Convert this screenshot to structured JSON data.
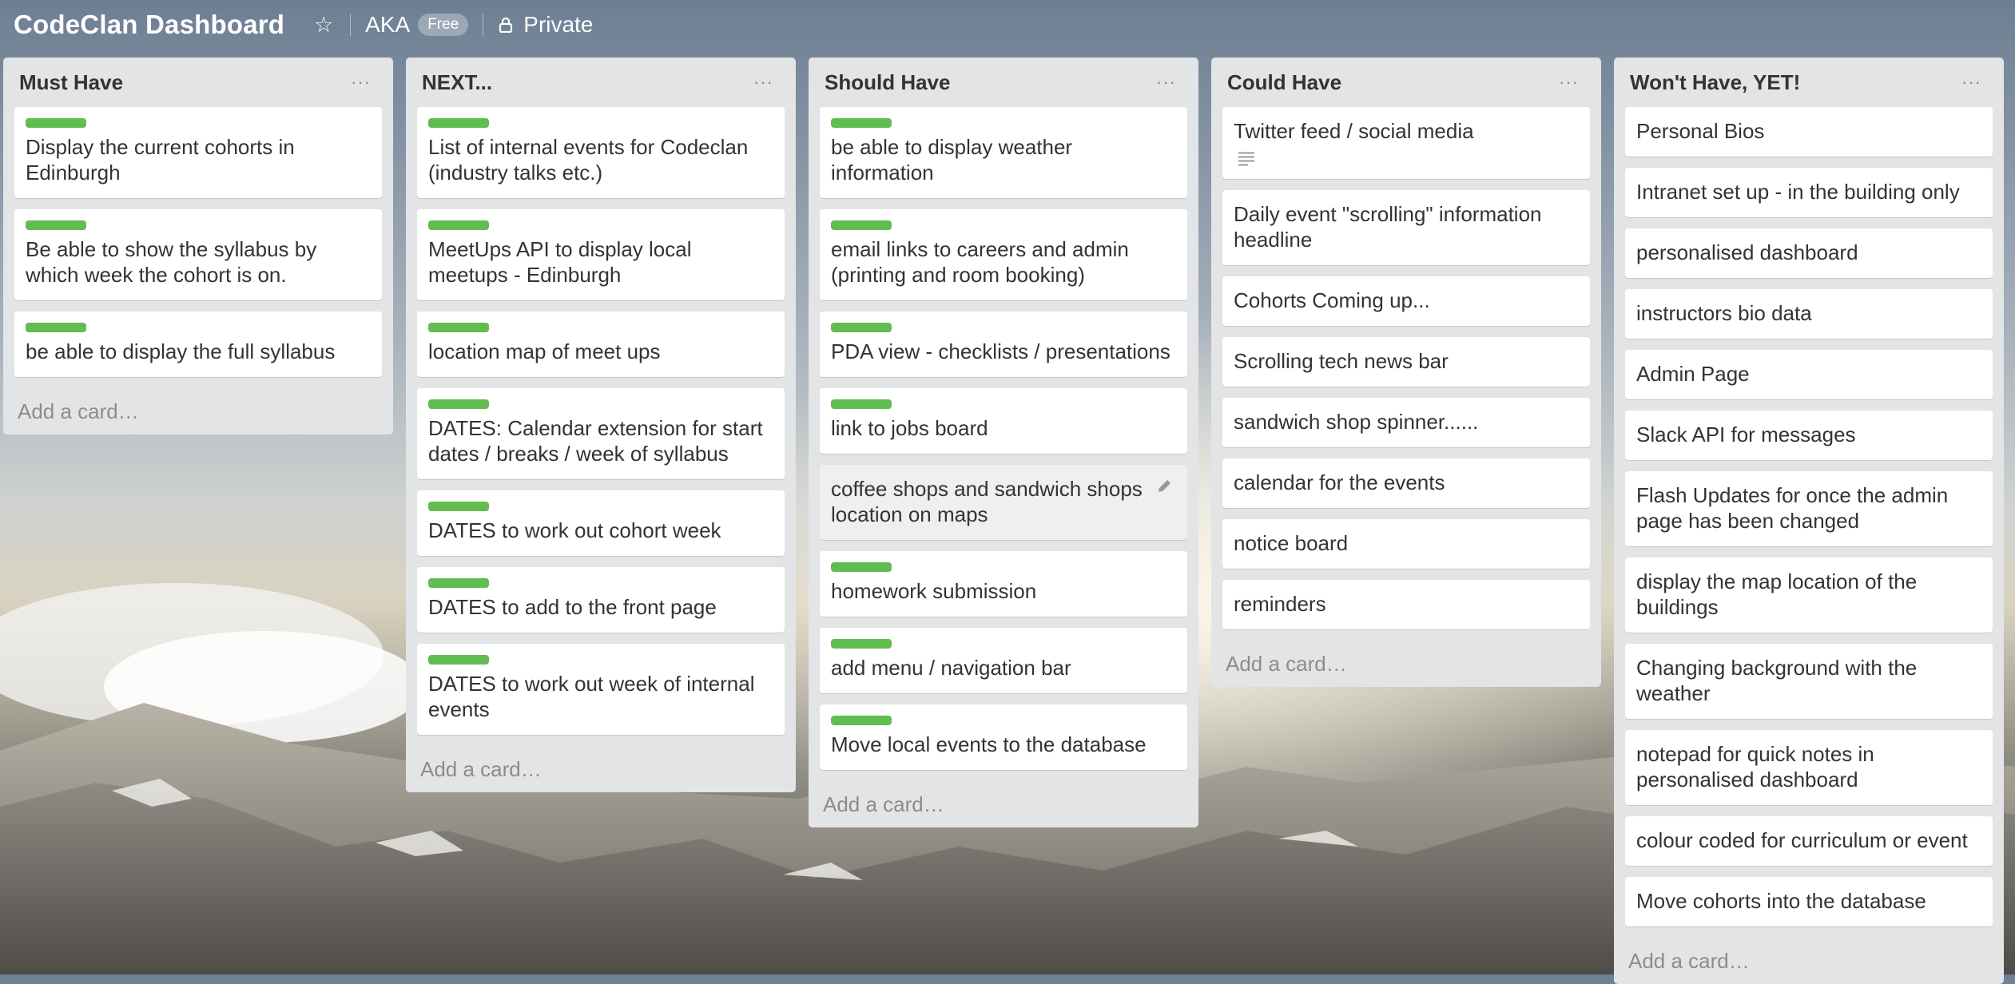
{
  "header": {
    "board_title": "CodeClan Dashboard",
    "team_name": "AKA",
    "team_badge": "Free",
    "privacy": "Private"
  },
  "add_card_label": "Add a card…",
  "lists": [
    {
      "title": "Must Have",
      "cards": [
        {
          "text": "Display the current cohorts in Edinburgh",
          "label": "green"
        },
        {
          "text": "Be able to show the syllabus by which week the cohort is on.",
          "label": "green"
        },
        {
          "text": "be able to display the full syllabus",
          "label": "green"
        }
      ]
    },
    {
      "title": "NEXT...",
      "cards": [
        {
          "text": "List of internal events for Codeclan (industry talks etc.)",
          "label": "green"
        },
        {
          "text": "MeetUps API to display local meetups - Edinburgh",
          "label": "green"
        },
        {
          "text": "location map of meet ups",
          "label": "green"
        },
        {
          "text": "DATES: Calendar extension for start dates / breaks / week of syllabus",
          "label": "green"
        },
        {
          "text": "DATES to work out cohort week",
          "label": "green"
        },
        {
          "text": "DATES to add to the front page",
          "label": "green"
        },
        {
          "text": "DATES to work out week of internal events",
          "label": "green"
        }
      ]
    },
    {
      "title": "Should Have",
      "cards": [
        {
          "text": "be able to display weather information",
          "label": "green"
        },
        {
          "text": "email links to careers and admin (printing and room booking)",
          "label": "green"
        },
        {
          "text": "PDA view - checklists / presentations",
          "label": "green"
        },
        {
          "text": "link to jobs board",
          "label": "green"
        },
        {
          "text": "coffee shops and sandwich shops location on maps",
          "label": "",
          "hover": true
        },
        {
          "text": "homework submission",
          "label": "green"
        },
        {
          "text": "add menu / navigation bar",
          "label": "green"
        },
        {
          "text": "Move local events to the database",
          "label": "green"
        }
      ]
    },
    {
      "title": "Could Have",
      "cards": [
        {
          "text": "Twitter feed / social media",
          "label": "",
          "has_description": true
        },
        {
          "text": "Daily event \"scrolling\" information headline",
          "label": ""
        },
        {
          "text": "Cohorts Coming up...",
          "label": ""
        },
        {
          "text": "Scrolling tech news bar",
          "label": ""
        },
        {
          "text": "sandwich shop spinner......",
          "label": ""
        },
        {
          "text": "calendar for the events",
          "label": ""
        },
        {
          "text": "notice board",
          "label": ""
        },
        {
          "text": "reminders",
          "label": ""
        }
      ]
    },
    {
      "title": "Won't Have, YET!",
      "cards": [
        {
          "text": "Personal Bios",
          "label": ""
        },
        {
          "text": "Intranet set up - in the building only",
          "label": ""
        },
        {
          "text": "personalised dashboard",
          "label": ""
        },
        {
          "text": "instructors bio data",
          "label": ""
        },
        {
          "text": "Admin Page",
          "label": ""
        },
        {
          "text": "Slack API for messages",
          "label": ""
        },
        {
          "text": "Flash Updates for once the admin page has been changed",
          "label": ""
        },
        {
          "text": "display the map location of the buildings",
          "label": ""
        },
        {
          "text": "Changing background with the weather",
          "label": ""
        },
        {
          "text": "notepad for quick notes in personalised dashboard",
          "label": ""
        },
        {
          "text": "colour coded for curriculum or event",
          "label": ""
        },
        {
          "text": "Move cohorts into the database",
          "label": ""
        }
      ]
    }
  ],
  "colors": {
    "label_green": "#61bd4f",
    "list_bg": "#e2e4e6"
  }
}
